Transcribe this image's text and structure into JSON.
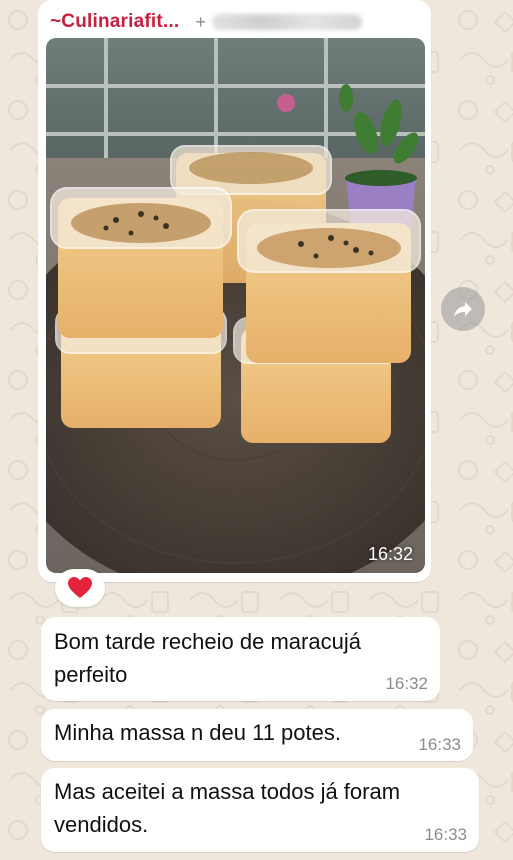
{
  "chat": {
    "sender_name": "~Culinariafit...",
    "sender_phone_prefix": "+"
  },
  "image_message": {
    "time": "16:32",
    "reaction": "❤️"
  },
  "messages": [
    {
      "line1": "Bom tarde recheio de maracujá",
      "line2": "perfeito",
      "time": "16:32"
    },
    {
      "line1": "Minha massa n deu 11 potes.",
      "time": "16:33"
    },
    {
      "line1": "Mas aceitei a massa todos já foram",
      "line2": "vendidos.",
      "time": "16:33"
    }
  ],
  "colors": {
    "wallpaper": "#efe7dc",
    "bubble": "#ffffff",
    "sender_name": "#c8213f",
    "timestamp": "#8c8c8c",
    "reaction_heart": "#e5223b"
  },
  "icons": {
    "forward": "forward-arrow-icon",
    "reaction": "heart-icon"
  }
}
